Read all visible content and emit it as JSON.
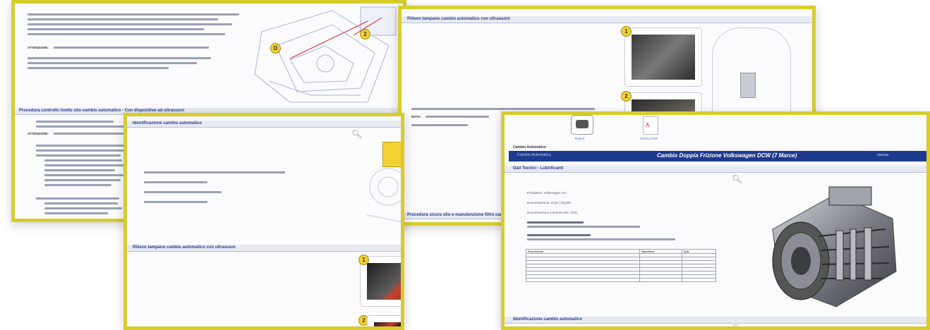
{
  "cards": {
    "c1": {
      "heading": "Procedura controllo livello olio cambio automatico - Con dispositivo ad ultrasuoni",
      "notice1": "ATTENZIONE:",
      "notice2": "ATTENZIONE:",
      "badge_a": "D",
      "badge_b": "2"
    },
    "c2": {
      "heading": "Rilievo tampano cambio automatico con ultrasuoni",
      "badge_a": "1",
      "badge_b": "2",
      "note": "NOTA:",
      "bottom_heading": "Procedura sicura olio e manutenzione filtro cambio automatico"
    },
    "c3": {
      "heading": "Identificazione cambio automatico",
      "heading2": "Rilievo tampano cambio automatico con ultrasuoni",
      "badge_a": "1",
      "badge_b": "2"
    },
    "c4": {
      "icon1_label": "Report",
      "icon2_label": "Scarica PDF",
      "section_label": "Cambio Automatico",
      "banner_left": "Cambio Automatico",
      "banner_title": "Cambio Doppia Frizione Volkswagen DCW (7 Marce)",
      "banner_right": "stampa",
      "sub_heading": "Dati Tecnici - Lubrificanti",
      "lines": [
        "Produttore: Volkswagen AG",
        "Denominazione: 0CW / DQ400",
        "Denominazione Commerciale: DSG"
      ],
      "table_headers": [
        "Descrizione",
        "Specifica",
        "Q.tà"
      ],
      "bottom_heading": "Identificazione cambio automatico"
    }
  }
}
